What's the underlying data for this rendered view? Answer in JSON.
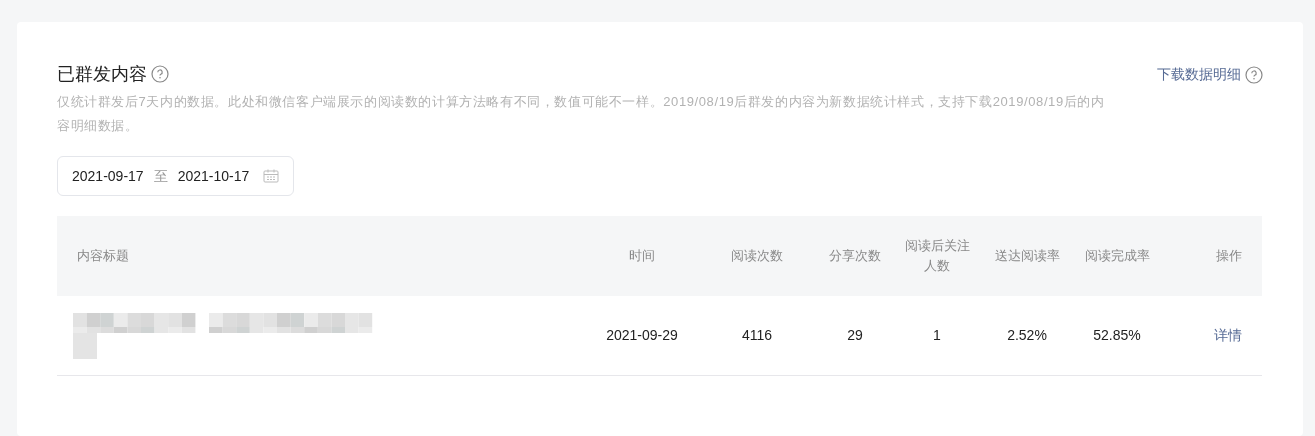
{
  "section": {
    "title": "已群发内容",
    "download_link": "下载数据明细",
    "description": "仅统计群发后7天内的数据。此处和微信客户端展示的阅读数的计算方法略有不同，数值可能不一样。2019/08/19后群发的内容为新数据统计样式，支持下载2019/08/19后的内容明细数据。"
  },
  "date_range": {
    "start": "2021-09-17",
    "separator": "至",
    "end": "2021-10-17"
  },
  "table": {
    "columns": [
      {
        "label": "内容标题"
      },
      {
        "label": "时间"
      },
      {
        "label": "阅读次数"
      },
      {
        "label": "分享次数"
      },
      {
        "label": "阅读后关注人数"
      },
      {
        "label": "送达阅读率"
      },
      {
        "label": "阅读完成率"
      },
      {
        "label": "操作"
      }
    ],
    "rows": [
      {
        "title": {
          "kind": "redacted"
        },
        "time": "2021-09-29",
        "reads": "4116",
        "shares": "29",
        "follows": "1",
        "delivery_read_rate": "2.52%",
        "completion_rate": "52.85%",
        "action": "详情"
      }
    ]
  }
}
